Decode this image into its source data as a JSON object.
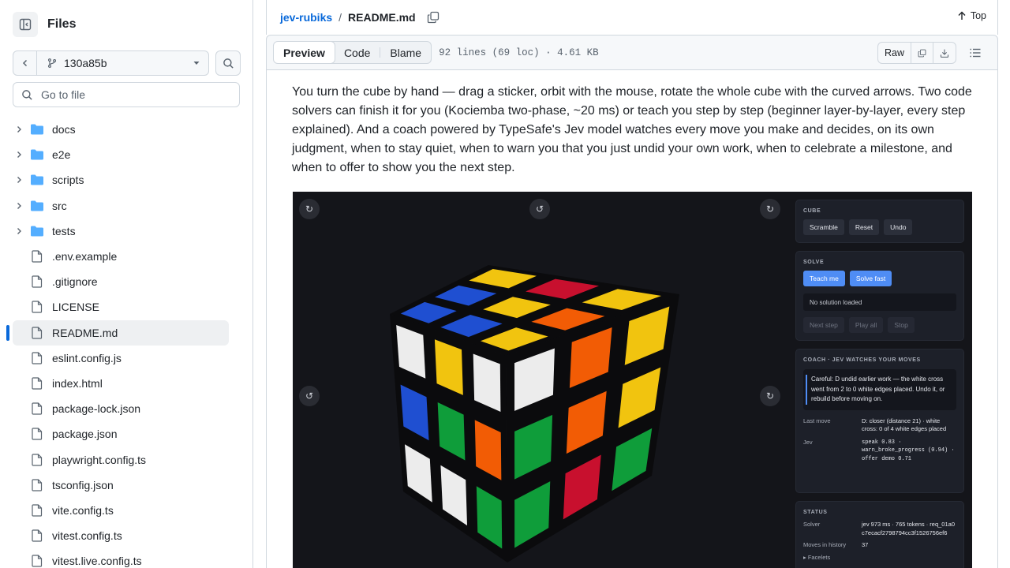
{
  "sidebar": {
    "title": "Files",
    "branch": "130a85b",
    "goto_placeholder": "Go to file",
    "items": [
      {
        "label": "docs",
        "type": "folder"
      },
      {
        "label": "e2e",
        "type": "folder"
      },
      {
        "label": "scripts",
        "type": "folder"
      },
      {
        "label": "src",
        "type": "folder"
      },
      {
        "label": "tests",
        "type": "folder"
      },
      {
        "label": ".env.example",
        "type": "file"
      },
      {
        "label": ".gitignore",
        "type": "file"
      },
      {
        "label": "LICENSE",
        "type": "file"
      },
      {
        "label": "README.md",
        "type": "file",
        "active": true
      },
      {
        "label": "eslint.config.js",
        "type": "file"
      },
      {
        "label": "index.html",
        "type": "file"
      },
      {
        "label": "package-lock.json",
        "type": "file"
      },
      {
        "label": "package.json",
        "type": "file"
      },
      {
        "label": "playwright.config.ts",
        "type": "file"
      },
      {
        "label": "tsconfig.json",
        "type": "file"
      },
      {
        "label": "vite.config.ts",
        "type": "file"
      },
      {
        "label": "vitest.config.ts",
        "type": "file"
      },
      {
        "label": "vitest.live.config.ts",
        "type": "file"
      }
    ]
  },
  "header": {
    "repo": "jev-rubiks",
    "separator": "/",
    "file": "README.md",
    "top_label": "Top"
  },
  "toolbar": {
    "tabs": [
      "Preview",
      "Code",
      "Blame"
    ],
    "active_tab": "Preview",
    "file_info": "92 lines (69 loc) · 4.61 KB",
    "raw_label": "Raw"
  },
  "readme": {
    "paragraph": "You turn the cube by hand — drag a sticker, orbit with the mouse, rotate the whole cube with the curved arrows. Two code solvers can finish it for you (Kociemba two-phase, ~20 ms) or teach you step by step (beginner layer-by-layer, every step explained). And a coach powered by TypeSafe's Jev model watches every move you make and decides, on its own judgment, when to stay quiet, when to warn you that you just undid your own work, when to celebrate a milestone, and when to offer to show you the next step."
  },
  "screenshot": {
    "cube_panel": {
      "title": "CUBE",
      "buttons": [
        "Scramble",
        "Reset",
        "Undo"
      ]
    },
    "solve_panel": {
      "title": "SOLVE",
      "buttons": [
        "Teach me",
        "Solve fast"
      ],
      "status": "No solution loaded",
      "controls": [
        "Next step",
        "Play all",
        "Stop"
      ]
    },
    "coach_panel": {
      "title": "COACH · JEV WATCHES YOUR MOVES",
      "message": "Careful: D undid earlier work — the white cross went from 2 to 0 white edges placed. Undo it, or rebuild before moving on.",
      "last_move_label": "Last move",
      "last_move_value": "D: closer (distance 21) · white cross: 0 of 4 white edges placed",
      "jev_label": "Jev",
      "jev_value": "speak 0.83 · warn_broke_progress (0.94) · offer demo 0.71"
    },
    "status_panel": {
      "title": "STATUS",
      "solver_label": "Solver",
      "solver_value": "jev 973 ms · 765 tokens · req_01a0c7ecacf2798794cc3f1526756ef6",
      "moves_label": "Moves in history",
      "moves_value": "37",
      "facelets_label": "▸ Facelets"
    },
    "colors": {
      "white": "#ececec",
      "yellow": "#f1c40f",
      "blue": "#1f4fd1",
      "red": "#c8102e",
      "green": "#0f9d3a",
      "orange": "#f25c05",
      "background": "#14151a",
      "accent": "#4f8df5"
    }
  }
}
